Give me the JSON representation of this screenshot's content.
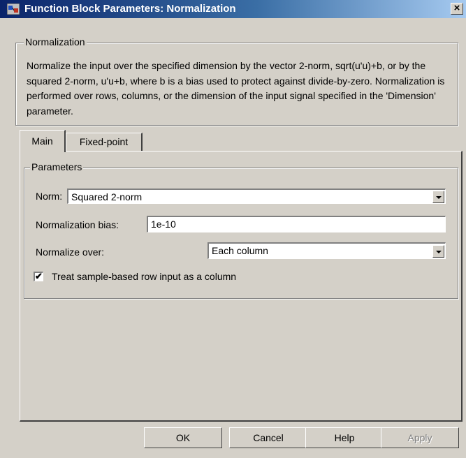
{
  "window": {
    "title": "Function Block Parameters: Normalization",
    "close_glyph": "×"
  },
  "description": {
    "group_label": "Normalization",
    "text": "Normalize the input over the specified dimension by the vector 2-norm, sqrt(u'u)+b, or by the squared 2-norm, u'u+b, where b is a bias used to protect against divide-by-zero.  Normalization is performed over rows, columns, or the dimension of the input signal specified in the 'Dimension' parameter."
  },
  "tabs": [
    {
      "label": "Main",
      "selected": true
    },
    {
      "label": "Fixed-point",
      "selected": false
    }
  ],
  "parameters": {
    "group_label": "Parameters",
    "norm": {
      "label": "Norm:",
      "value": "Squared 2-norm"
    },
    "bias": {
      "label": "Normalization bias:",
      "value": "1e-10"
    },
    "normalize_over": {
      "label": "Normalize over:",
      "value": "Each column"
    },
    "treat_row": {
      "label": "Treat sample-based row input as a column",
      "checked": true,
      "mark": "✔"
    }
  },
  "buttons": {
    "ok": "OK",
    "cancel": "Cancel",
    "help": "Help",
    "apply": "Apply"
  },
  "colors": {
    "title_start": "#0a246a",
    "title_end": "#a6caf0",
    "face": "#d4d0c8"
  }
}
